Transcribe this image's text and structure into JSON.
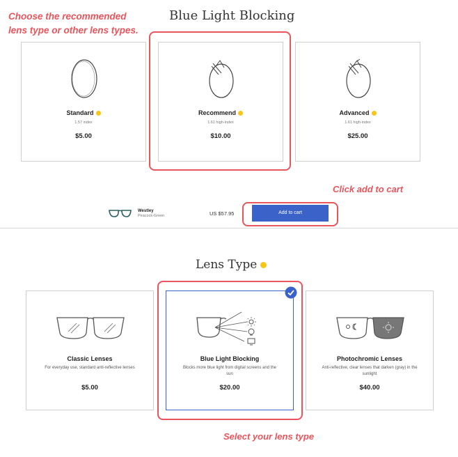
{
  "annotations": {
    "choose_line1": "Choose the recommended",
    "choose_line2": "lens type or other lens types.",
    "click_add": "Click add to cart",
    "select_lens": "Select your lens type"
  },
  "section1": {
    "title": "Blue Light Blocking",
    "cards": [
      {
        "name": "Standard",
        "sub": "1.57 index",
        "price": "$5.00"
      },
      {
        "name": "Recommend",
        "sub": "1.61 high-index",
        "price": "$10.00"
      },
      {
        "name": "Advanced",
        "sub": "1.61 high-index",
        "price": "$25.00"
      }
    ]
  },
  "cart": {
    "product_name": "Westley",
    "product_color": "Peacock-Green",
    "price": "US $57.95",
    "add_label": "Add to cart"
  },
  "section2": {
    "title": "Lens Type",
    "cards": [
      {
        "name": "Classic Lenses",
        "desc": "For everyday use, standard anti-reflective lenses",
        "price": "$5.00"
      },
      {
        "name": "Blue Light Blocking",
        "desc": "Blocks more blue light from digital screens and the sun",
        "price": "$20.00"
      },
      {
        "name": "Photochromic Lenses",
        "desc": "Anti-reflective, clear lenses that darken (gray) in the sunlight",
        "price": "$40.00"
      }
    ]
  },
  "colors": {
    "annotation": "#e8555c",
    "button": "#3b62c9",
    "info": "#f5c518",
    "selected_border": "#3b62c9"
  }
}
